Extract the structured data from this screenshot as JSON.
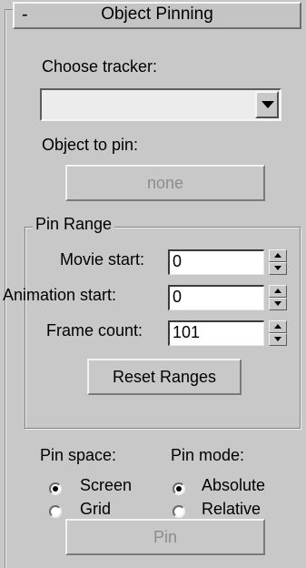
{
  "rollout": {
    "collapse_symbol": "-",
    "title": "Object Pinning"
  },
  "tracker": {
    "label": "Choose tracker:",
    "selected_value": ""
  },
  "object_to_pin": {
    "label": "Object to pin:",
    "button_label": "none",
    "enabled": false
  },
  "pin_range": {
    "group_title": "Pin Range",
    "fields": [
      {
        "label": "Movie start:",
        "value": "0"
      },
      {
        "label": "Animation start:",
        "value": "0"
      },
      {
        "label": "Frame count:",
        "value": "101"
      }
    ],
    "reset_button_label": "Reset Ranges"
  },
  "pin_space": {
    "label": "Pin space:",
    "options": [
      {
        "label": "Screen",
        "checked": true
      },
      {
        "label": "Grid",
        "checked": false
      }
    ]
  },
  "pin_mode": {
    "label": "Pin mode:",
    "options": [
      {
        "label": "Absolute",
        "checked": true
      },
      {
        "label": "Relative",
        "checked": false
      }
    ]
  },
  "pin_button": {
    "label": "Pin",
    "enabled": false
  }
}
